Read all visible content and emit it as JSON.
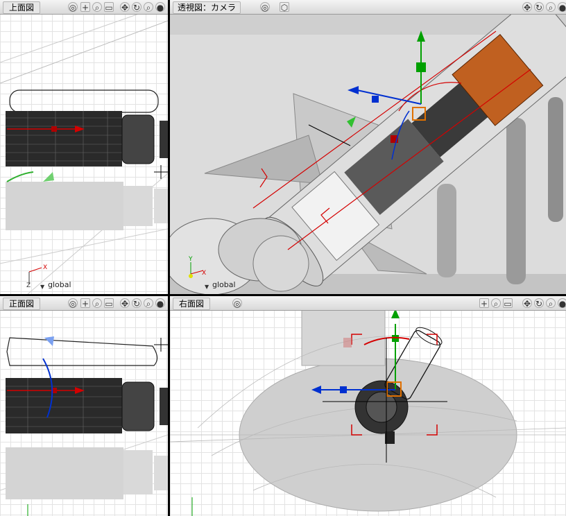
{
  "viewports": {
    "top": {
      "title": "上面図",
      "coord_label": "global"
    },
    "perspective": {
      "title": "透視図：カメラ",
      "coord_label": "global"
    },
    "front": {
      "title": "正面図"
    },
    "right": {
      "title": "右面図"
    }
  },
  "icons": {
    "header_left": [
      "spiral-icon",
      "move-icon",
      "zoom-icon",
      "camera-icon"
    ],
    "header_right": [
      "move-icon",
      "rotate-icon",
      "zoom-icon",
      "sphere-icon"
    ],
    "perspective_extra": [
      "spiral-icon",
      "cube-icon"
    ]
  },
  "axis_labels": {
    "x": "X",
    "y": "Y",
    "z": "Z"
  },
  "colors": {
    "x_axis": "#d40000",
    "y_axis": "#00a000",
    "z_axis": "#0030d0",
    "selection": "#e07000",
    "model": "#2a2a2a",
    "ghost": "#c8c8c8"
  }
}
